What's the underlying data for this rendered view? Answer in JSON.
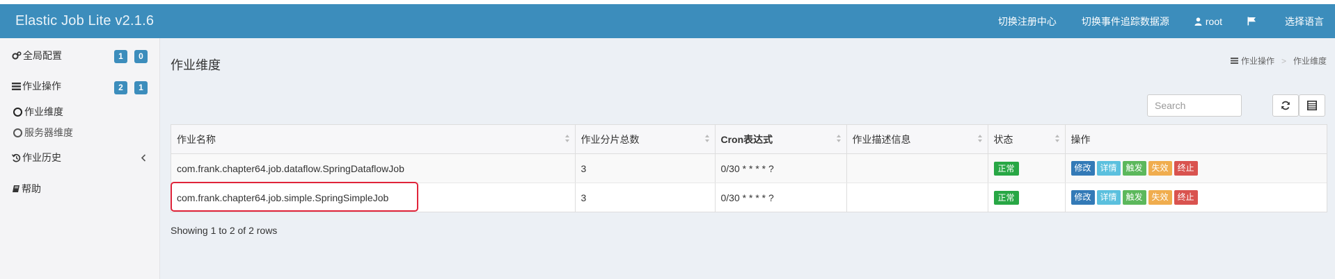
{
  "app": {
    "title": "Elastic Job Lite v2.1.6"
  },
  "nav": {
    "links": [
      "切换注册中心",
      "切换事件追踪数据源",
      "root",
      "",
      "选择语言"
    ]
  },
  "sidebar": {
    "items": [
      {
        "label": "全局配置",
        "icon": "gears-icon",
        "badges": [
          "1",
          "0"
        ]
      },
      {
        "label": "作业操作",
        "icon": "tasks-icon",
        "badges": [
          "2",
          "1"
        ]
      },
      {
        "label": "作业历史",
        "icon": "history-icon"
      },
      {
        "label": "帮助",
        "icon": "book-icon"
      }
    ],
    "subitems": [
      "作业维度",
      "服务器维度"
    ]
  },
  "page": {
    "title": "作业维度",
    "breadcrumb": [
      "作业操作",
      "作业维度"
    ]
  },
  "toolbar": {
    "search_placeholder": "Search"
  },
  "table": {
    "headers": [
      "作业名称",
      "作业分片总数",
      "Cron表达式",
      "作业描述信息",
      "状态",
      "操作"
    ],
    "rows": [
      {
        "name": "com.frank.chapter64.job.dataflow.SpringDataflowJob",
        "shards": "3",
        "cron": "0/30 * * * * ?",
        "desc": "",
        "status": "正常"
      },
      {
        "name": "com.frank.chapter64.job.simple.SpringSimpleJob",
        "shards": "3",
        "cron": "0/30 * * * * ?",
        "desc": "",
        "status": "正常"
      }
    ],
    "actions": [
      "修改",
      "详情",
      "触发",
      "失效",
      "终止"
    ],
    "footer": "Showing 1 to 2 of 2 rows"
  },
  "colors": {
    "navbar": "#3c8dbc",
    "badge": "#3c8dbc",
    "status_ok": "#28a745",
    "highlight": "#e0243a"
  }
}
